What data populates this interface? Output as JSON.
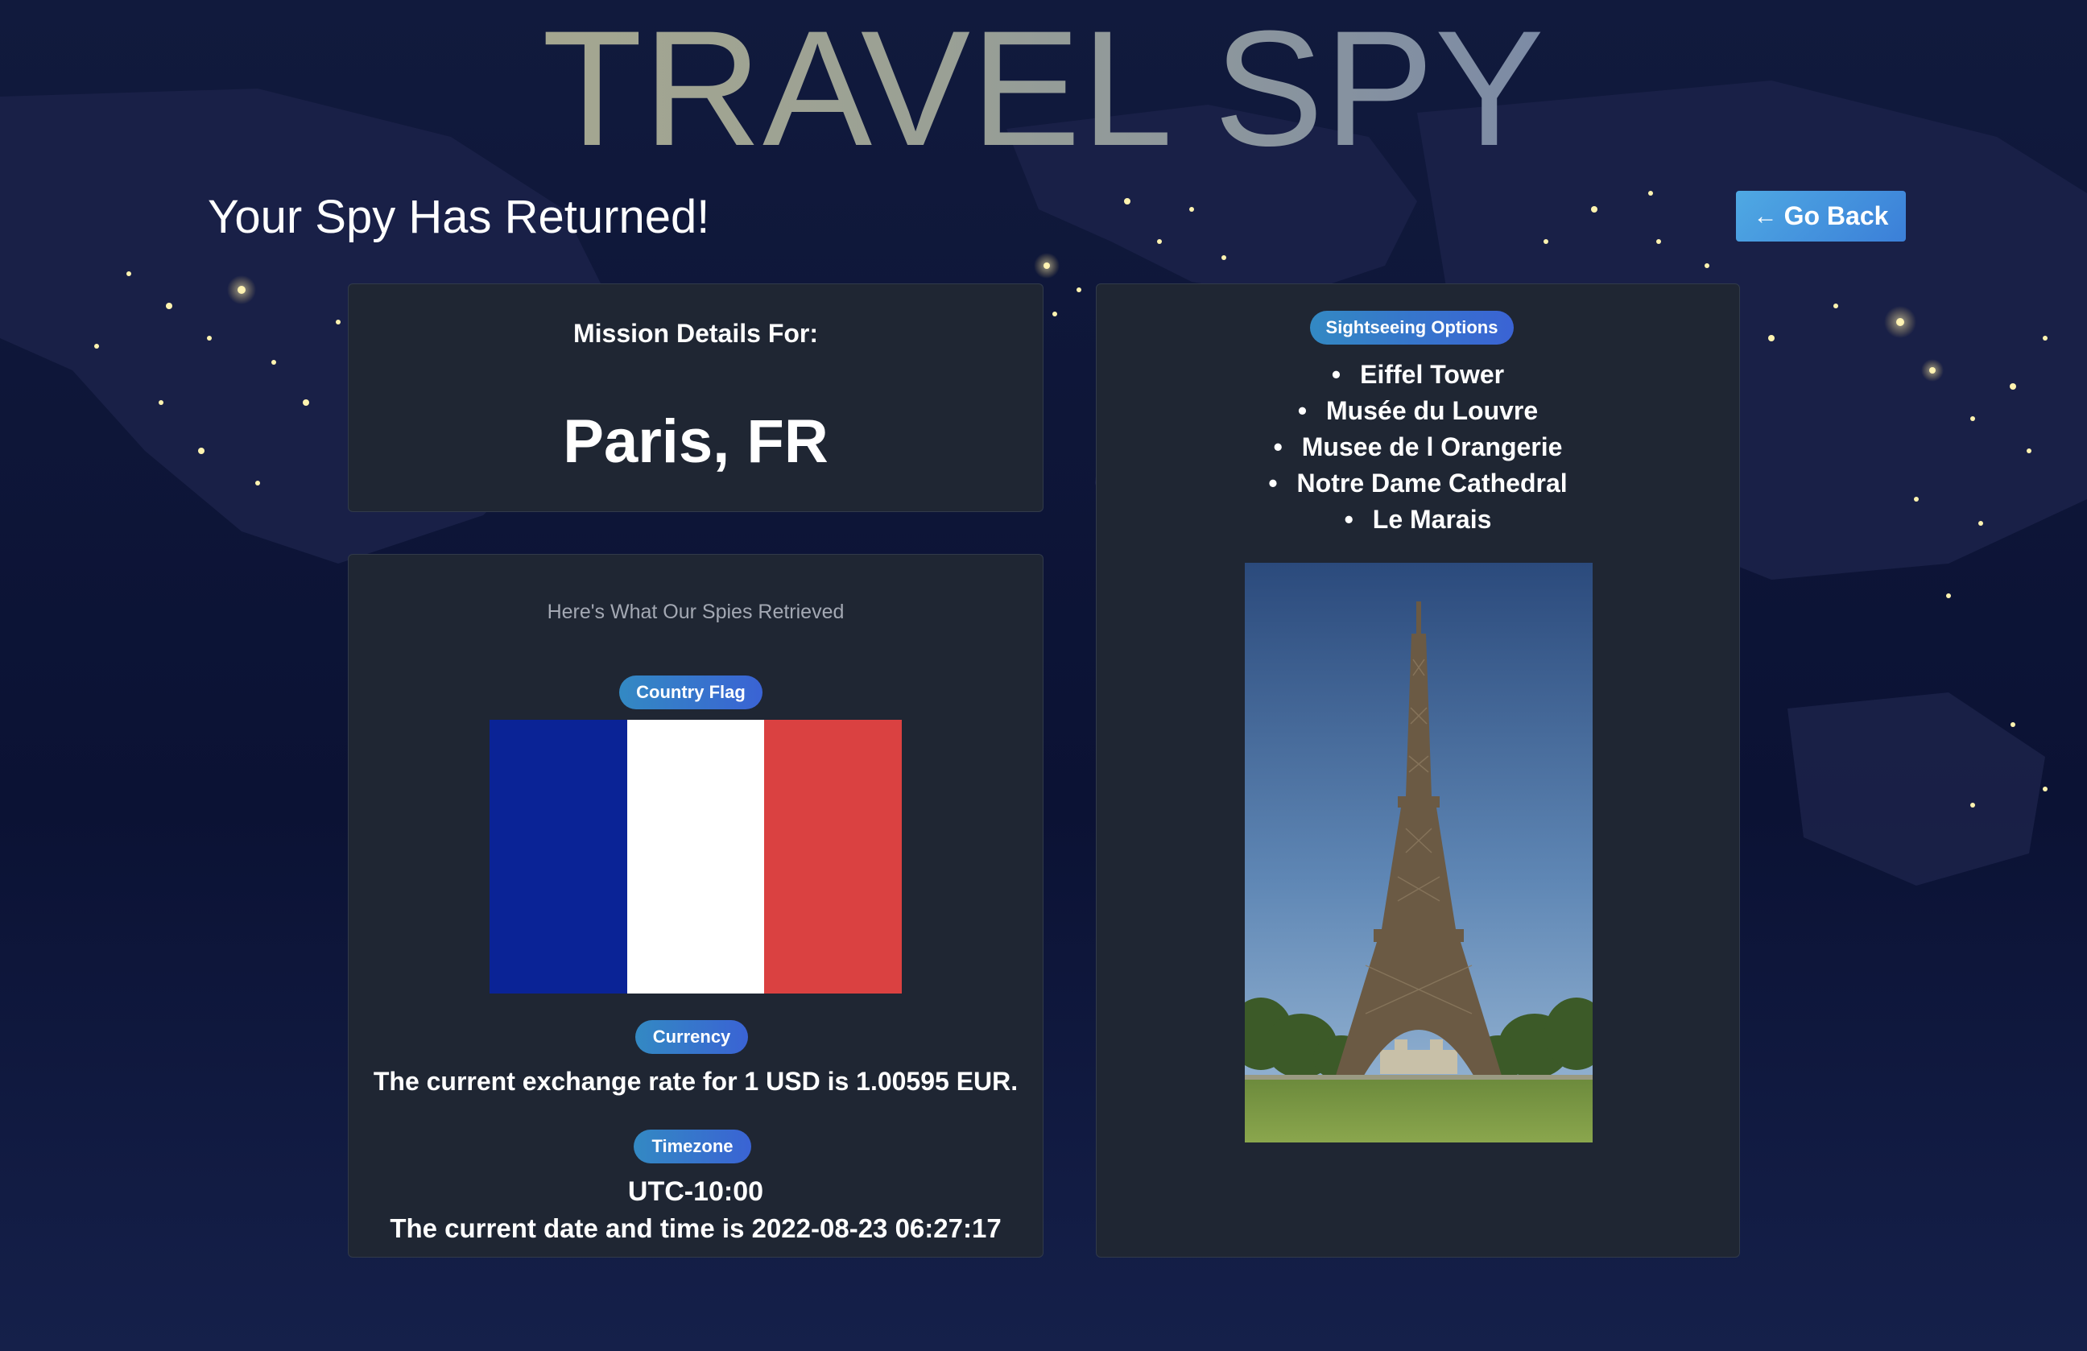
{
  "header": {
    "app_title": "TRAVEL SPY",
    "headline": "Your Spy Has Returned!",
    "go_back_label": "Go Back"
  },
  "mission": {
    "label": "Mission Details For:",
    "city": "Paris, FR"
  },
  "info": {
    "subtitle": "Here's What Our Spies Retrieved",
    "flag_badge": "Country Flag",
    "flag_colors": [
      "#0a2396",
      "#ffffff",
      "#da4141"
    ],
    "currency_badge": "Currency",
    "exchange_text": "The current exchange rate for 1 USD is 1.00595 EUR.",
    "timezone_badge": "Timezone",
    "timezone_offset": "UTC-10:00",
    "datetime_text": "The current date and time is 2022-08-23 06:27:17"
  },
  "sightseeing": {
    "badge": "Sightseeing Options",
    "items": [
      "Eiffel Tower",
      "Musée du Louvre",
      "Musee de l Orangerie",
      "Notre Dame Cathedral",
      "Le Marais"
    ],
    "photo_subject": "Eiffel Tower"
  },
  "colors": {
    "card_bg": "#1f2633",
    "button_accent": "#3b87dc",
    "badge_accent": "#3a6fd0"
  },
  "icons": {
    "back": "arrow-left-icon"
  }
}
